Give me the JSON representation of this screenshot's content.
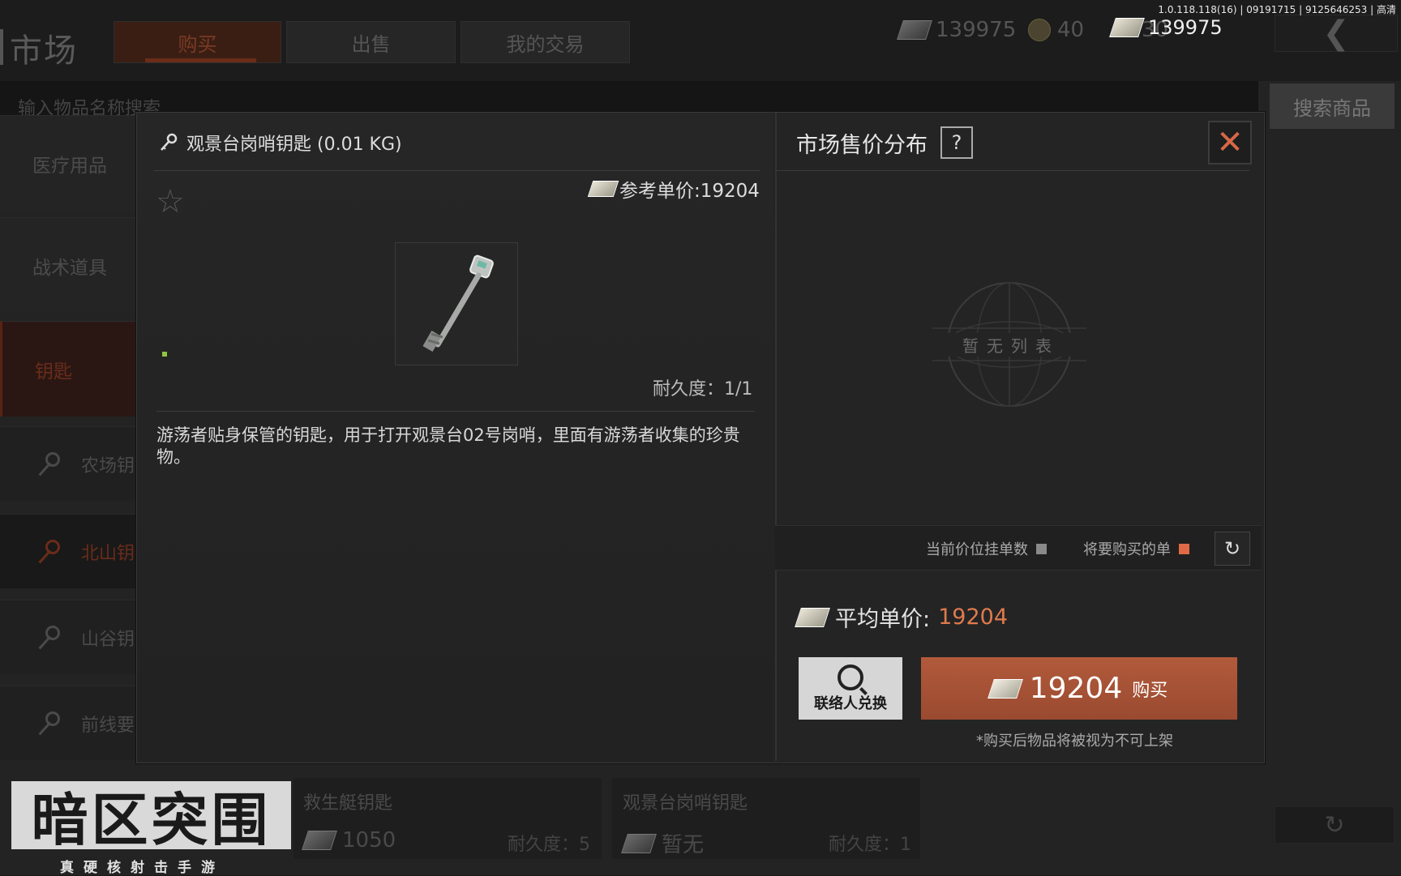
{
  "version_info": "1.0.118.118(16) | 09191715 | 9125646253 | 高清",
  "market": {
    "title": "市场",
    "tabs": [
      {
        "label": "购买",
        "active": true
      },
      {
        "label": "出售",
        "active": false
      },
      {
        "label": "我的交易",
        "active": false
      }
    ],
    "currency_cash": "139975",
    "currency_coin": "40",
    "currency_partial": "30",
    "wallet_front": "139975",
    "search_placeholder": "输入物品名称搜索",
    "search_button": "搜索商品",
    "categories": [
      {
        "label": "医疗用品",
        "active": false
      },
      {
        "label": "战术道具",
        "active": false
      },
      {
        "label": "钥匙",
        "active": true
      }
    ],
    "subitems": [
      {
        "label": "农场钥",
        "active": false
      },
      {
        "label": "北山钥",
        "active": true
      },
      {
        "label": "山谷钥",
        "active": false
      },
      {
        "label": "前线要",
        "active": false
      }
    ],
    "bottom_cards": [
      {
        "name": "救生艇钥匙",
        "price": "1050",
        "durability": "耐久度：5"
      },
      {
        "name": "观景台岗哨钥匙",
        "price": "暂无",
        "durability": "耐久度：1"
      }
    ],
    "logo_text": "暗区突围",
    "logo_sub": "真硬核射击手游"
  },
  "modal": {
    "item_title": "观景台岗哨钥匙 (0.01 KG)",
    "ref_price": "参考单价:19204",
    "durability": "耐久度：1/1",
    "description": "游荡者贴身保管的钥匙，用于打开观景台02号岗哨，里面有游荡者收集的珍贵物。",
    "right_title": "市场售价分布",
    "help": "?",
    "close": "✕",
    "empty_list": "暂无列表",
    "legend_current": "当前价位挂单数",
    "legend_buy": "将要购买的单",
    "legend_current_color": "#8a8a8a",
    "legend_buy_color": "#e06a45",
    "avg_label": "平均单价:",
    "avg_value": "19204",
    "avg_color": "#e07a4e",
    "contact_label": "联络人兑换",
    "buy_price": "19204",
    "buy_label": "购买",
    "buy_note": "*购买后物品将被视为不可上架"
  },
  "icons": [
    "star-icon",
    "key-icon",
    "cash-icon",
    "coin-icon",
    "close-icon",
    "refresh-icon",
    "search-icon",
    "back-arrow-icon",
    "globe-icon"
  ]
}
